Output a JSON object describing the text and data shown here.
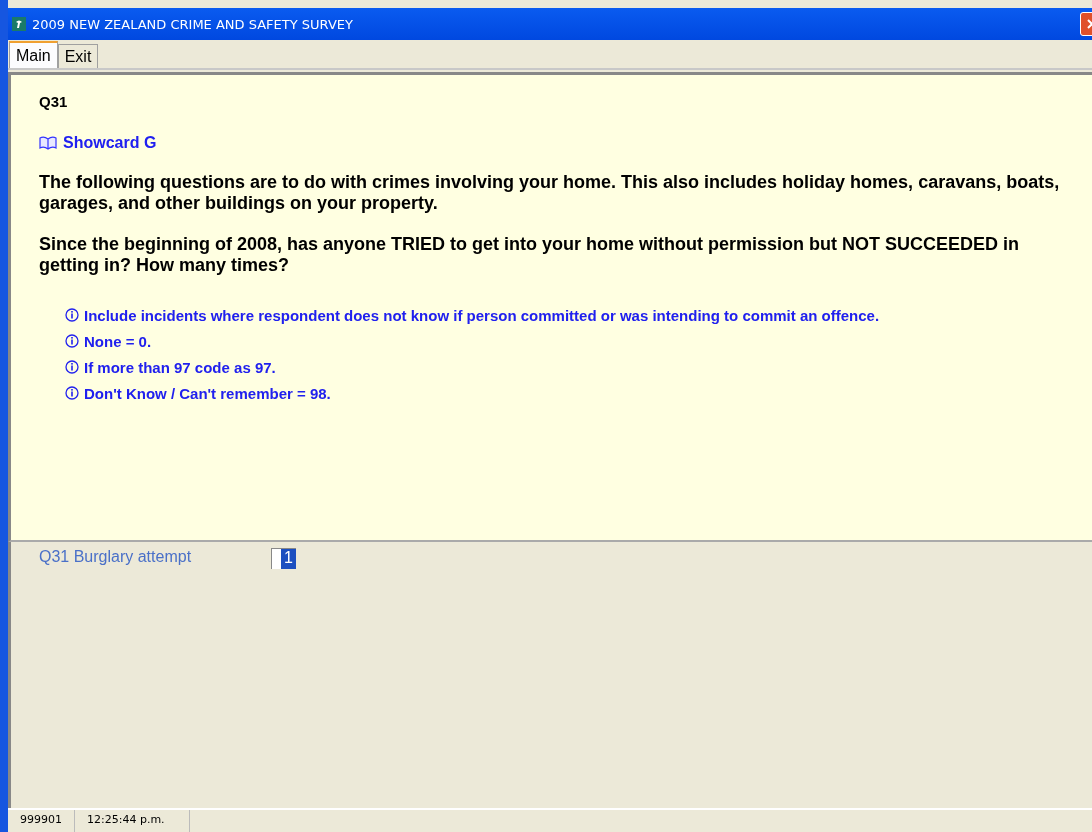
{
  "window": {
    "title": "2009 NEW ZEALAND CRIME AND SAFETY SURVEY"
  },
  "tabs": [
    {
      "label": "Main",
      "selected": true
    },
    {
      "label": "Exit",
      "selected": false
    }
  ],
  "question": {
    "number": "Q31",
    "showcard": "Showcard G",
    "paragraphs": [
      "The following questions are to do with crimes involving your home. This also includes holiday homes, caravans, boats, garages, and other buildings on your property.",
      "Since the beginning of 2008, has anyone TRIED to get into your home without permission but NOT SUCCEEDED in getting in? How many times?"
    ],
    "instructions": [
      "Include incidents where respondent does not know if person committed or was intending to commit an offence.",
      "None = 0.",
      "If more than 97 code as 97.",
      "Don't Know / Can't remember = 98."
    ]
  },
  "answer": {
    "label": "Q31 Burglary attempt",
    "value": "1"
  },
  "status_bar": [
    "999901",
    "12:25:44 p.m."
  ]
}
